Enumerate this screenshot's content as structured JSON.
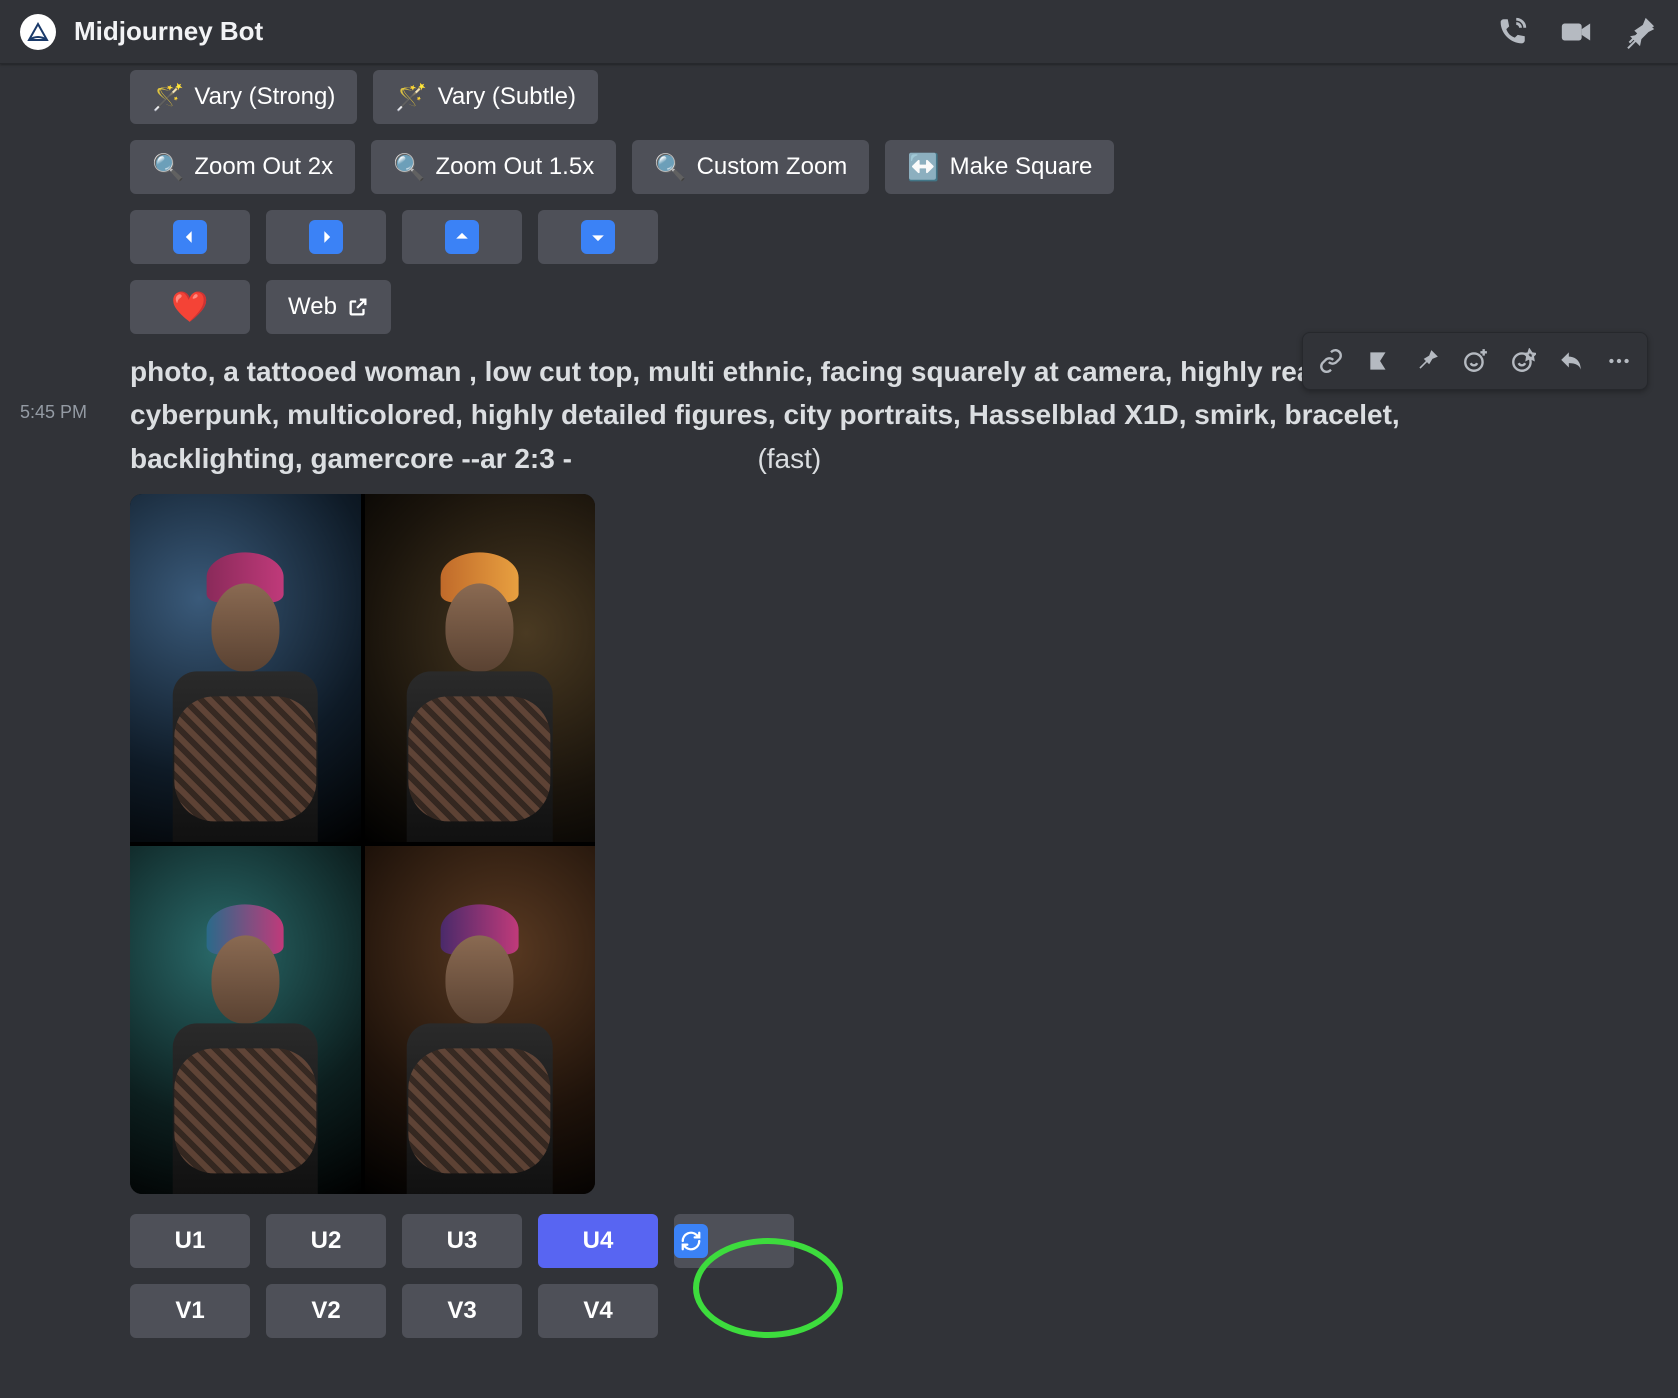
{
  "header": {
    "title": "Midjourney Bot"
  },
  "toolbar": {
    "vary_strong": "Vary (Strong)",
    "vary_subtle": "Vary (Subtle)",
    "zoom_out_2x": "Zoom Out 2x",
    "zoom_out_15x": "Zoom Out 1.5x",
    "custom_zoom": "Custom Zoom",
    "make_square": "Make Square",
    "web": "Web"
  },
  "message": {
    "timestamp": "5:45 PM",
    "prompt": "photo, a tattooed woman , low cut top, multi ethnic, facing squarely at camera, highly realistic skin, cyberpunk, multicolored, highly detailed figures, city portraits, Hasselblad X1D, smirk, bracelet, backlighting, gamercore --ar 2:3 -",
    "speed": "(fast)"
  },
  "grid_buttons": {
    "u": [
      "U1",
      "U2",
      "U3",
      "U4"
    ],
    "v": [
      "V1",
      "V2",
      "V3",
      "V4"
    ]
  }
}
